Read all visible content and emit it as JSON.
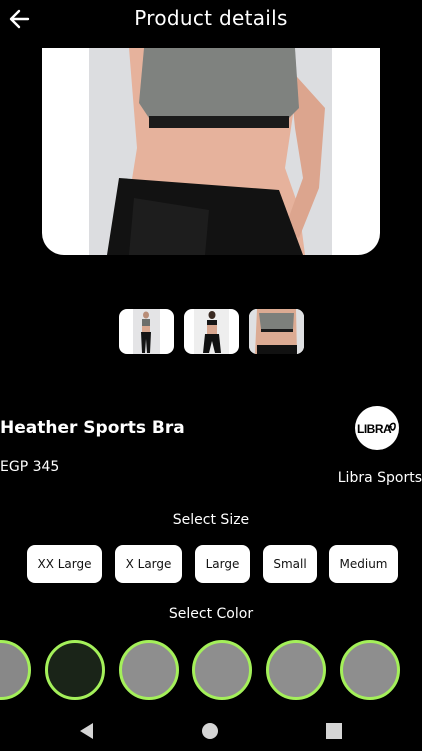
{
  "header": {
    "title": "Product details",
    "back_icon": "arrow-left-icon"
  },
  "product": {
    "main_image": "sports-bra-front-photo",
    "thumbnails": [
      {
        "name": "full-body-front"
      },
      {
        "name": "back-view"
      },
      {
        "name": "close-up-front"
      }
    ],
    "name": "Heather Sports Bra",
    "price": "EGP 345",
    "brand": {
      "name": "Libra Sports",
      "logo_text": "LIBRA"
    }
  },
  "size_section": {
    "title": "Select Size",
    "sizes": [
      "XX Large",
      "X Large",
      "Large",
      "Small",
      "Medium"
    ]
  },
  "color_section": {
    "title": "Select Color",
    "swatches": [
      {
        "color": "#888888"
      },
      {
        "color": "#1a2418"
      },
      {
        "color": "#8e8e8e"
      },
      {
        "color": "#8e8e8e"
      },
      {
        "color": "#8e8e8e"
      },
      {
        "color": "#8e8e8e"
      }
    ],
    "ring_color": "#a4f05a"
  },
  "system_nav": {
    "buttons": [
      "back-triangle-icon",
      "home-circle-icon",
      "recents-square-icon"
    ]
  }
}
